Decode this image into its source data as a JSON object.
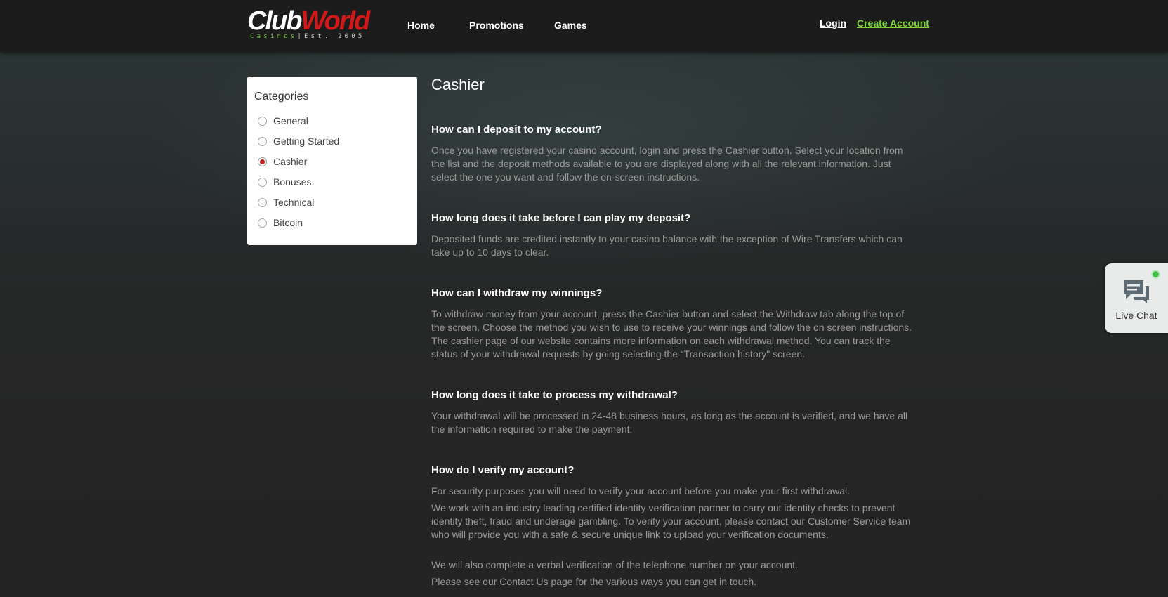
{
  "header": {
    "logo": {
      "club": "Club",
      "world": "World",
      "tagline_casinos": "Casinos",
      "tagline_separator": "|",
      "tagline_est": "Est. 2005"
    },
    "nav": [
      "Home",
      "Promotions",
      "Games"
    ],
    "login_label": "Login",
    "create_account_label": "Create Account"
  },
  "sidebar": {
    "title": "Categories",
    "items": [
      {
        "label": "General",
        "selected": false
      },
      {
        "label": "Getting Started",
        "selected": false
      },
      {
        "label": "Cashier",
        "selected": true
      },
      {
        "label": "Bonuses",
        "selected": false
      },
      {
        "label": "Technical",
        "selected": false
      },
      {
        "label": "Bitcoin",
        "selected": false
      }
    ]
  },
  "main": {
    "title": "Cashier",
    "faqs": [
      {
        "question": "How can I deposit to my account?",
        "answer": "Once you have registered your casino account, login and press the Cashier button. Select your location from the list and the deposit methods available to you are displayed along with all the relevant information. Just select the one you want and follow the on-screen instructions."
      },
      {
        "question": "How long does it take before I can play my deposit?",
        "answer": "Deposited funds are credited instantly to your casino balance with the exception of Wire Transfers which can take up to 10 days to clear."
      },
      {
        "question": "How can I withdraw my winnings?",
        "answer": "To withdraw money from your account, press the Cashier button and select the Withdraw tab along the top of the screen. Choose the method you wish to use to receive your winnings and follow the on screen instructions. The cashier page of our website contains more information on each withdrawal method. You can track the status of your withdrawal requests by going selecting the “Transaction history\" screen."
      },
      {
        "question": "How long does it take to process my withdrawal?",
        "answer": "Your withdrawal will be processed in 24-48 business hours, as long as the account is verified, and we have all the information required to make the payment."
      },
      {
        "question": "How do I verify my account?",
        "answer_p1": "For security purposes you will need to verify your account before you make your first withdrawal.",
        "answer_p2": "We work with an industry leading certified identity verification partner to carry out identity checks to prevent identity theft, fraud and underage gambling. To verify your account, please contact our Customer Service team who will provide you with a safe & secure unique link to upload your verification documents.",
        "answer_p3": "We will also complete a verbal verification of the telephone number on your account.",
        "answer_p4_before": "Please see our",
        "answer_p4_link": "Contact Us",
        "answer_p4_after": "page for the various ways you can get in touch."
      }
    ]
  },
  "live_chat": {
    "label": "Live Chat",
    "status_color": "#3ec24a",
    "icon": "chat-bubbles-icon"
  },
  "colors": {
    "accent_red": "#c81e1e",
    "create_account_green": "#7dd43a",
    "background": "#242424"
  }
}
